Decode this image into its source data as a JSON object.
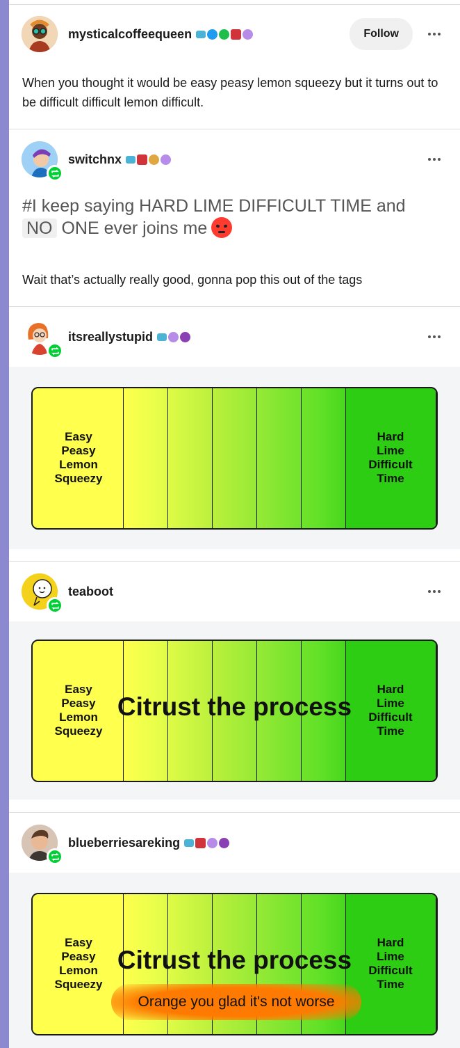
{
  "posts": [
    {
      "username": "mysticalcoffeequeen",
      "follow_label": "Follow",
      "text": "When you thought it would be easy peasy lemon squeezy but it turns out to be difficult difficult lemon difficult."
    },
    {
      "username": "switchnx",
      "tag_text": "#I keep saying HARD LIME DIFFICULT TIME and",
      "tag_text_2_chip": "NO",
      "tag_text_2_rest": " ONE ever joins me",
      "text": "Wait that’s actually really good, gonna pop this out of the tags"
    },
    {
      "username": "itsreallystupid",
      "image": {
        "left_label": "Easy\nPeasy\nLemon\nSqueezy",
        "right_label": "Hard\nLime\nDifficult\nTime"
      }
    },
    {
      "username": "teaboot",
      "image": {
        "left_label": "Easy\nPeasy\nLemon\nSqueezy",
        "right_label": "Hard\nLime\nDifficult\nTime",
        "caption": "Citrust the process"
      }
    },
    {
      "username": "blueberriesareking",
      "image": {
        "left_label": "Easy\nPeasy\nLemon\nSqueezy",
        "right_label": "Hard\nLime\nDifficult\nTime",
        "caption": "Citrust the process",
        "orange_caption": "Orange you glad it's not worse"
      }
    }
  ],
  "colors": {
    "rail": "#8c89d1",
    "reblog_green": "#00cf35",
    "lemon": "#ffff4d",
    "lime": "#2ccd12",
    "orange": "#ff7a00"
  },
  "icons": {
    "reblog": "reblog-icon",
    "more": "ellipsis-icon",
    "emoji": "angry-face-emoji"
  }
}
